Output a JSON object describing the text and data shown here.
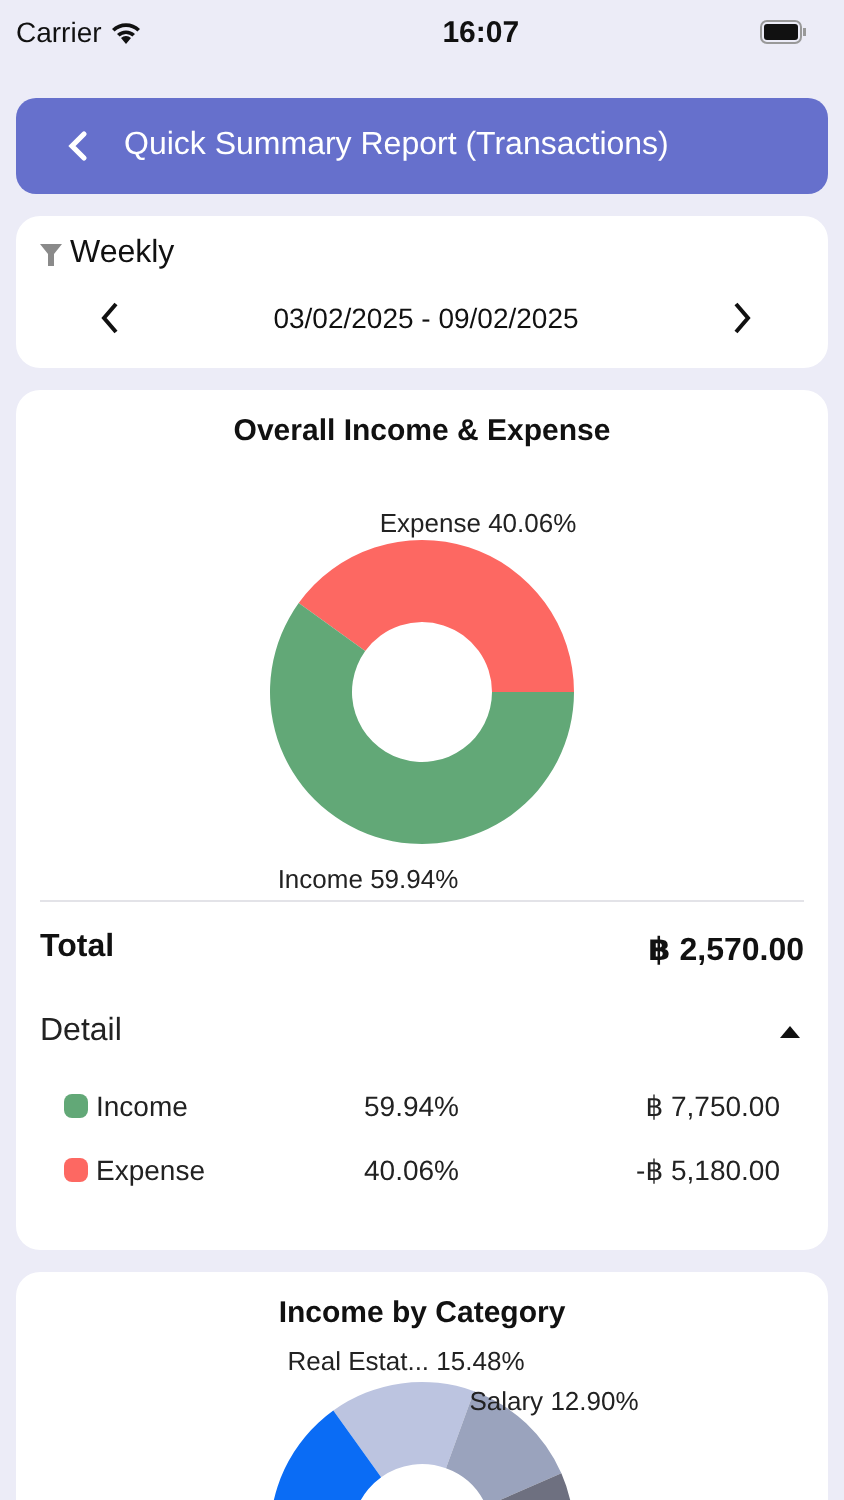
{
  "status_bar": {
    "carrier": "Carrier",
    "time": "16:07"
  },
  "header": {
    "title": "Quick Summary Report (Transactions)"
  },
  "filter": {
    "period": "Weekly",
    "range": "03/02/2025 - 09/02/2025"
  },
  "overall": {
    "title": "Overall Income & Expense",
    "chart_data": {
      "type": "donut",
      "categories": [
        "Expense",
        "Income"
      ],
      "values": [
        40.06,
        59.94
      ],
      "colors": [
        "#fd6862",
        "#62a877"
      ],
      "value_labels": [
        "40.06%",
        "59.94%"
      ]
    },
    "total_label": "Total",
    "total_value": "฿ 2,570.00",
    "detail_label": "Detail",
    "expanded": true,
    "rows": [
      {
        "name": "Income",
        "percent": "59.94%",
        "amount": "฿ 7,750.00",
        "color": "#62a877"
      },
      {
        "name": "Expense",
        "percent": "40.06%",
        "amount": "-฿ 5,180.00",
        "color": "#fd6862"
      }
    ]
  },
  "income_by_category": {
    "title": "Income by Category",
    "chart_data": {
      "type": "donut",
      "categories": [
        "Real Estat...",
        "Salary",
        null,
        null
      ],
      "values": [
        15.48,
        12.9,
        7.1,
        64.52
      ],
      "colors": [
        "#bcc4e0",
        "#9aa3bd",
        "#6e7080",
        "#0a6cf5"
      ],
      "value_labels": [
        "15.48%",
        "12.90%",
        null,
        null
      ]
    }
  }
}
